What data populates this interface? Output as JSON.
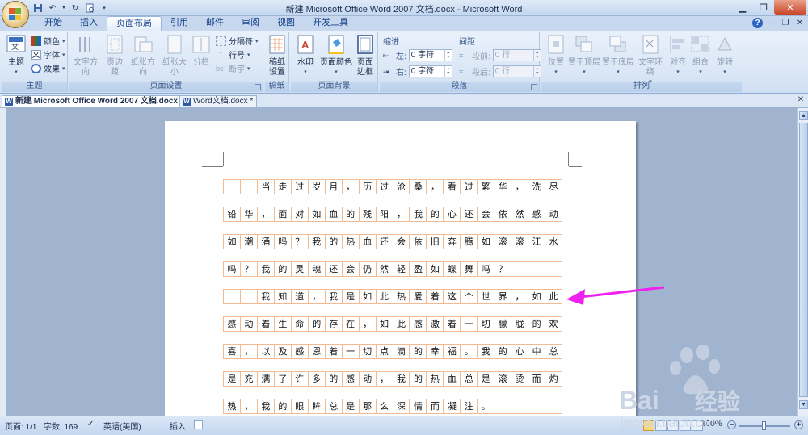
{
  "window": {
    "title": "新建 Microsoft Office Word 2007 文档.docx - Microsoft Word",
    "help_label": "?"
  },
  "tabs": [
    {
      "label": "开始",
      "active": false
    },
    {
      "label": "插入",
      "active": false
    },
    {
      "label": "页面布局",
      "active": true
    },
    {
      "label": "引用",
      "active": false
    },
    {
      "label": "邮件",
      "active": false
    },
    {
      "label": "审阅",
      "active": false
    },
    {
      "label": "视图",
      "active": false
    },
    {
      "label": "开发工具",
      "active": false
    }
  ],
  "ribbon": {
    "themes": {
      "group_label": "主题",
      "theme_button": "主题",
      "colors": "颜色",
      "fonts": "字体",
      "effects": "效果"
    },
    "page_setup": {
      "group_label": "页面设置",
      "text_direction": "文字方向",
      "margins": "页边距",
      "orientation": "纸张方向",
      "size": "纸张大小",
      "columns": "分栏",
      "breaks": "分隔符",
      "line_numbers": "行号",
      "hyphenation": "断字"
    },
    "draft": {
      "group_label": "稿纸",
      "button": "稿纸设置"
    },
    "page_background": {
      "group_label": "页面背景",
      "watermark": "水印",
      "page_color": "页面颜色",
      "page_borders": "页面边框"
    },
    "paragraph": {
      "group_label": "段落",
      "indent_heading": "缩进",
      "spacing_heading": "间距",
      "left_label": "左:",
      "right_label": "右:",
      "left_value": "0 字符",
      "right_value": "0 字符",
      "before_label": "段前:",
      "after_label": "段后:",
      "before_value": "0 行",
      "after_value": "0 行"
    },
    "arrange": {
      "group_label": "排列",
      "position": "位置",
      "bring_front": "置于顶层",
      "send_back": "置于底层",
      "text_wrap": "文字环绕",
      "align": "对齐",
      "group": "组合",
      "rotate": "旋转"
    }
  },
  "doc_tabs": [
    {
      "label": "新建 Microsoft Office Word 2007 文档.docx *",
      "active": true
    },
    {
      "label": "Word文档.docx *",
      "active": false
    }
  ],
  "document": {
    "rows": [
      [
        "",
        "",
        "当",
        "走",
        "过",
        "岁",
        "月",
        "，",
        "历",
        "过",
        "沧",
        "桑",
        "，",
        "看",
        "过",
        "繁",
        "华",
        "，",
        "洗",
        "尽"
      ],
      [
        "铅",
        "华",
        "，",
        "面",
        "对",
        "如",
        "血",
        "的",
        "残",
        "阳",
        "，",
        "我",
        "的",
        "心",
        "还",
        "会",
        "依",
        "然",
        "感",
        "动"
      ],
      [
        "如",
        "潮",
        "涌",
        "吗",
        "？",
        "我",
        "的",
        "热",
        "血",
        "还",
        "会",
        "依",
        "旧",
        "奔",
        "腾",
        "如",
        "滚",
        "滚",
        "江",
        "水"
      ],
      [
        "吗",
        "？",
        "我",
        "的",
        "灵",
        "魂",
        "还",
        "会",
        "仍",
        "然",
        "轻",
        "盈",
        "如",
        "蝶",
        "舞",
        "吗",
        "？",
        "",
        "",
        ""
      ],
      [
        "",
        "",
        "我",
        "知",
        "道",
        "，",
        "我",
        "是",
        "如",
        "此",
        "热",
        "爱",
        "着",
        "这",
        "个",
        "世",
        "界",
        "，",
        "如",
        "此"
      ],
      [
        "感",
        "动",
        "着",
        "生",
        "命",
        "的",
        "存",
        "在",
        "，",
        "如",
        "此",
        "感",
        "激",
        "着",
        "一",
        "切",
        "朦",
        "胧",
        "的",
        "欢"
      ],
      [
        "喜",
        "，",
        "以",
        "及",
        "感",
        "恩",
        "着",
        "一",
        "切",
        "点",
        "滴",
        "的",
        "幸",
        "福",
        "。",
        "我",
        "的",
        "心",
        "中",
        "总"
      ],
      [
        "是",
        "充",
        "满",
        "了",
        "许",
        "多",
        "的",
        "感",
        "动",
        "，",
        "我",
        "的",
        "热",
        "血",
        "总",
        "是",
        "滚",
        "烫",
        "而",
        "灼"
      ],
      [
        "热",
        "，",
        "我",
        "的",
        "眼",
        "眸",
        "总",
        "是",
        "那",
        "么",
        "深",
        "情",
        "而",
        "凝",
        "注",
        "。",
        "",
        "",
        "",
        ""
      ]
    ]
  },
  "statusbar": {
    "page": "页面: 1/1",
    "words": "字数: 169",
    "language": "英语(美国)",
    "mode": "插入",
    "zoom": "100%"
  },
  "watermark": {
    "brand": "Bai",
    "brand_cn": "经验",
    "url": "jingyan.baidu.com"
  },
  "colors": {
    "accent": "#ee22ee",
    "grid_line": "#f3b98f"
  }
}
